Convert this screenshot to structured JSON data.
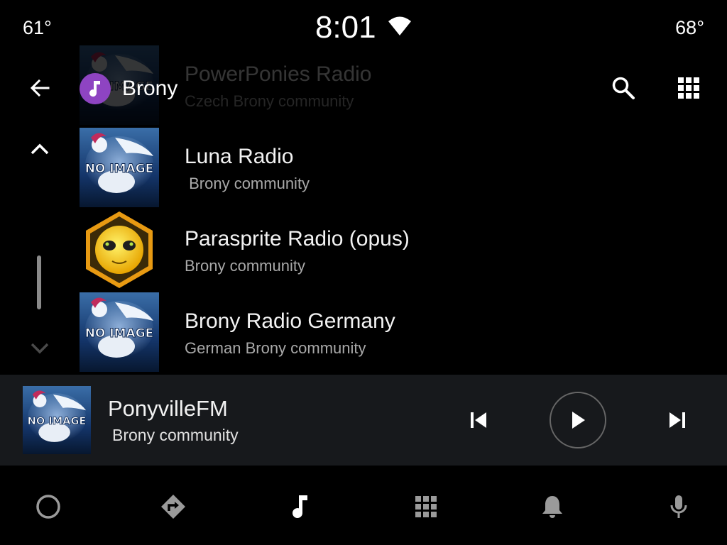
{
  "status_bar": {
    "temp_left": "61°",
    "time": "8:01",
    "temp_right": "68°"
  },
  "header": {
    "title": "Brony",
    "back_icon": "arrow-back-icon",
    "app_icon": "music-note-icon",
    "search_icon": "search-icon",
    "apps_icon": "apps-grid-icon",
    "app_badge_color": "#8e44c2"
  },
  "scroll": {
    "up_icon": "chevron-up-icon",
    "down_icon": "chevron-down-icon"
  },
  "list": {
    "items": [
      {
        "title": "PowerPonies Radio",
        "subtitle": "Czech Brony community",
        "art": "no-image-pony"
      },
      {
        "title": "Luna Radio",
        "subtitle": " Brony community",
        "art": "no-image-pony"
      },
      {
        "title": "Parasprite Radio (opus)",
        "subtitle": "Brony community",
        "art": "parasprite-hexagon-logo"
      },
      {
        "title": "Brony Radio Germany",
        "subtitle": "German Brony community",
        "art": "no-image-pony"
      }
    ]
  },
  "now_playing": {
    "title": "PonyvilleFM",
    "subtitle": "Brony community",
    "art": "no-image-pony",
    "prev_icon": "skip-previous-icon",
    "play_icon": "play-icon",
    "next_icon": "skip-next-icon"
  },
  "bottom_nav": {
    "items": [
      {
        "icon": "home-circle-icon"
      },
      {
        "icon": "navigation-icon"
      },
      {
        "icon": "music-note-icon",
        "active": true
      },
      {
        "icon": "apps-grid-icon"
      },
      {
        "icon": "notification-bell-icon"
      },
      {
        "icon": "microphone-icon"
      }
    ]
  },
  "colors": {
    "background": "#000000",
    "now_playing_bg": "#17191c",
    "inactive_icon": "#9a9a9a",
    "subtitle": "#a9a9a9"
  }
}
